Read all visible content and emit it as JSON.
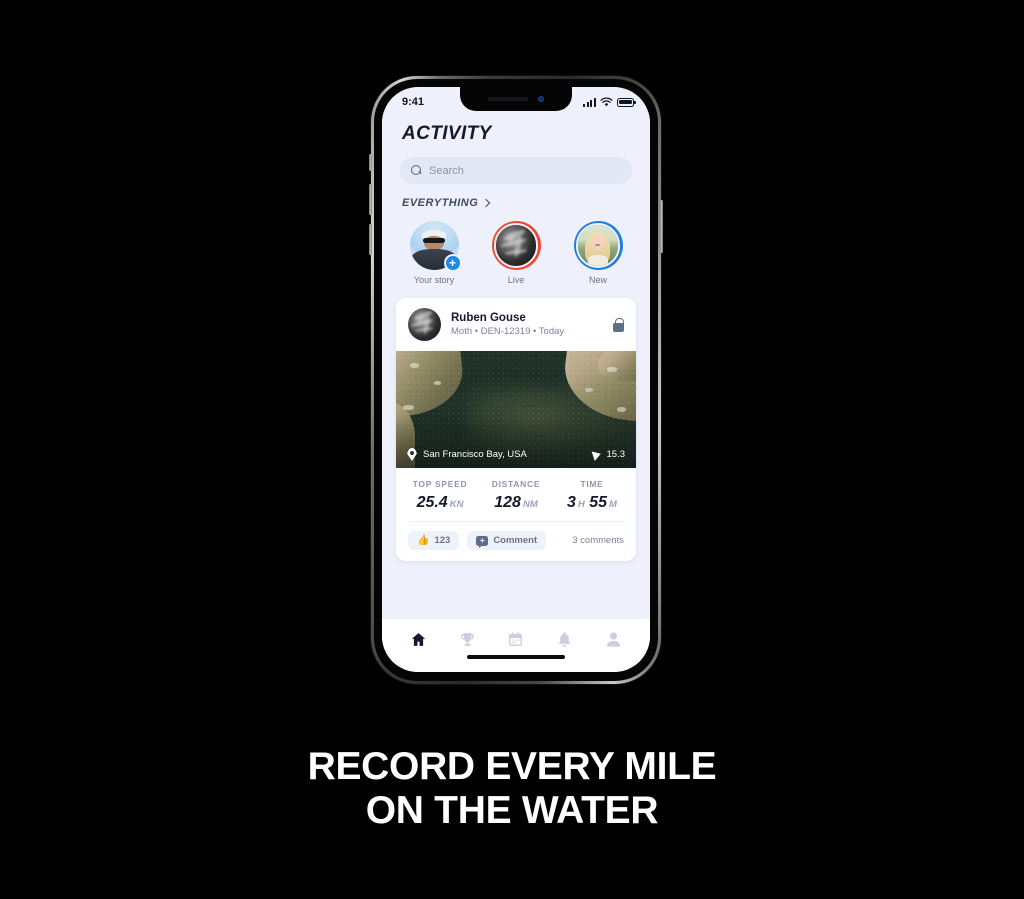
{
  "statusbar": {
    "time": "9:41",
    "signal_icon": "cellular-bars-icon",
    "wifi_icon": "wifi-icon",
    "battery_icon": "battery-icon"
  },
  "app": {
    "title": "ACTIVITY",
    "search": {
      "placeholder": "Search",
      "icon": "search-icon"
    },
    "section": {
      "label": "EVERYTHING",
      "chevron_icon": "chevron-right-icon"
    },
    "stories": [
      {
        "label": "Your story",
        "ring": "none",
        "badge": "+",
        "avatar": "your-story-avatar"
      },
      {
        "label": "Live",
        "ring": "#f0452e",
        "avatar": "live-avatar"
      },
      {
        "label": "New",
        "ring": "#1f7fe0",
        "avatar": "new-avatar"
      }
    ],
    "post": {
      "author": "Ruben Gouse",
      "meta": "Moth • DEN-12319 • Today",
      "privacy_icon": "lock-icon",
      "map": {
        "location": "San Francisco Bay, USA",
        "location_icon": "map-pin-icon",
        "speed": "15.3",
        "speed_icon": "sail-triangle-icon"
      },
      "stats": [
        {
          "key": "TOP SPEED",
          "value": "25.4",
          "unit": "KN"
        },
        {
          "key": "DISTANCE",
          "value": "128",
          "unit": "NM"
        },
        {
          "key": "TIME",
          "value": "3",
          "unit": "H",
          "value2": "55",
          "unit2": "M"
        }
      ],
      "actions": {
        "like_count": "123",
        "like_icon": "thumbs-up-icon",
        "comment_label": "Comment",
        "comment_icon": "comment-bubble-icon",
        "comments_count": "3 comments"
      }
    },
    "tabs": [
      {
        "name": "home",
        "icon": "home-icon",
        "active": true
      },
      {
        "name": "trophy",
        "icon": "trophy-icon",
        "active": false
      },
      {
        "name": "calendar",
        "icon": "calendar-icon",
        "active": false
      },
      {
        "name": "notifications",
        "icon": "bell-icon",
        "active": false
      },
      {
        "name": "profile",
        "icon": "person-icon",
        "active": false
      }
    ]
  },
  "headline": {
    "line1": "RECORD EVERY MILE",
    "line2": "ON THE WATER"
  },
  "colors": {
    "background": "#000000",
    "screen_bg": "#eef1fb",
    "accent_blue": "#2089e8",
    "live_red": "#f0452e",
    "ink": "#121a2c"
  }
}
